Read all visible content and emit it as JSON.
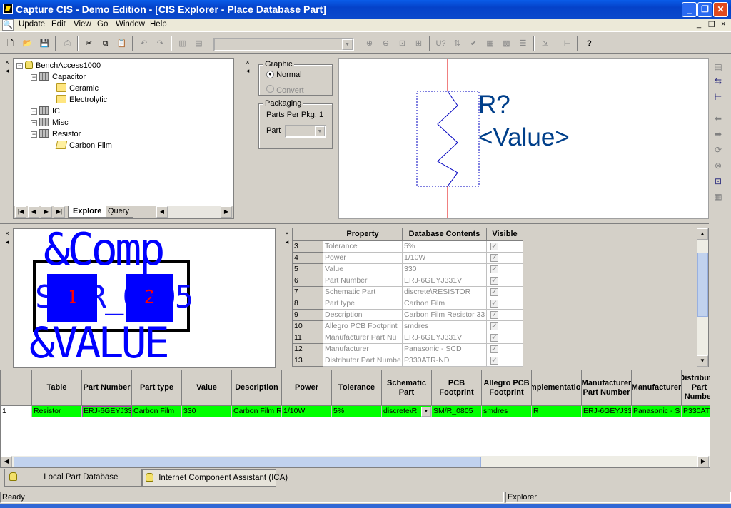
{
  "window": {
    "title": "Capture CIS - Demo Edition - [CIS Explorer - Place Database Part]",
    "min": "_",
    "max": "❐",
    "close": "✕"
  },
  "menu": [
    "Update",
    "Edit",
    "View",
    "Go",
    "Window",
    "Help"
  ],
  "mdi": {
    "min": "_",
    "restore": "❐",
    "close": "×"
  },
  "toolbar": {
    "combo_value": ""
  },
  "tree": {
    "root": "BenchAccess1000",
    "items": [
      {
        "label": "Capacitor",
        "exp": "−"
      },
      {
        "label": "Ceramic"
      },
      {
        "label": "Electrolytic"
      },
      {
        "label": "IC",
        "exp": "+"
      },
      {
        "label": "Misc",
        "exp": "+"
      },
      {
        "label": "Resistor",
        "exp": "−"
      },
      {
        "label": "Carbon Film"
      }
    ],
    "tabs": [
      "Explore",
      "Query"
    ]
  },
  "graphic": {
    "legend": "Graphic",
    "normal": "Normal",
    "convert": "Convert"
  },
  "packaging": {
    "legend": "Packaging",
    "ppk_label": "Parts Per Pkg:",
    "ppk_value": "1",
    "part_label": "Part",
    "part_value": ""
  },
  "symbol": {
    "refdes": "R?",
    "value": "<Value>"
  },
  "footprint": {
    "line1": "&Comp",
    "line2": "SM/R_0805",
    "line3": "&VALUE",
    "pad1": "1",
    "pad2": "2"
  },
  "props": {
    "headers": [
      "Property",
      "Database Contents",
      "Visible"
    ],
    "rows": [
      {
        "n": "3",
        "p": "Tolerance",
        "v": "5%"
      },
      {
        "n": "4",
        "p": "Power",
        "v": "1/10W"
      },
      {
        "n": "5",
        "p": "Value",
        "v": "330"
      },
      {
        "n": "6",
        "p": "Part Number",
        "v": "ERJ-6GEYJ331V"
      },
      {
        "n": "7",
        "p": "Schematic Part",
        "v": "discrete\\RESISTOR"
      },
      {
        "n": "8",
        "p": "Part type",
        "v": "Carbon Film"
      },
      {
        "n": "9",
        "p": "Description",
        "v": "Carbon Film Resistor 33"
      },
      {
        "n": "10",
        "p": "Allegro PCB Footprint",
        "v": "smdres"
      },
      {
        "n": "11",
        "p": "Manufacturer Part Nu",
        "v": "ERJ-6GEYJ331V"
      },
      {
        "n": "12",
        "p": "Manufacturer",
        "v": "Panasonic - SCD"
      },
      {
        "n": "13",
        "p": "Distributor Part Numbe",
        "v": "P330ATR-ND"
      }
    ],
    "check": "✓"
  },
  "results": {
    "headers": [
      "Table",
      "Part Number",
      "Part type",
      "Value",
      "Description",
      "Power",
      "Tolerance",
      "Schematic Part",
      "PCB Footprint",
      "Allegro PCB Footprint",
      "Implementation",
      "Manufacturer Part Number",
      "Manufacturer",
      "Distributor Part Number"
    ],
    "row": {
      "n": "1",
      "cells": [
        "Resistor",
        "ERJ-6GEYJ33",
        "Carbon Film",
        "330",
        "Carbon Film R",
        "1/10W",
        "5%",
        "discrete\\R",
        "SM/R_0805",
        "smdres",
        "R",
        "ERJ-6GEYJ33",
        "Panasonic - S",
        "P330AT"
      ]
    }
  },
  "bottom_tabs": [
    "Local Part Database",
    "Internet Component Assistant (ICA)"
  ],
  "status": {
    "left": "Ready",
    "right": "Explorer"
  },
  "colors": {
    "title_blue": "#0842c8",
    "green_row": "#00ff00",
    "footprint_blue": "#0000ff",
    "symbol_blue": "#003f8a"
  }
}
